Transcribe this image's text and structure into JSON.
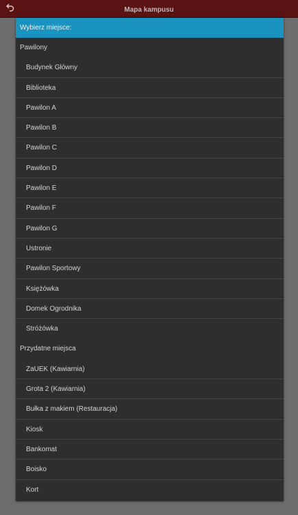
{
  "app_bar": {
    "title": "Mapa kampusu",
    "back_icon": "undo-arrow-icon"
  },
  "dialog": {
    "header": "Wybierz miejsce:",
    "sections": [
      {
        "title": "Pawilony",
        "items": [
          "Budynek Główny",
          "Biblioteka",
          "Pawilon A",
          "Pawilon B",
          "Pawilon C",
          "Pawilon D",
          "Pawilon E",
          "Pawilon F",
          "Pawilon G",
          "Ustronie",
          "Pawilon Sportowy",
          "Księżówka",
          "Domek Ogrodnika",
          "Stróżówka"
        ]
      },
      {
        "title": "Przydatne miejsca",
        "items": [
          "ZaUEK (Kawiarnia)",
          "Grota 2 (Kawiarnia)",
          "Bułka z makiem (Restauracja)",
          "Kiosk",
          "Bankomat",
          "Boisko",
          "Kort"
        ]
      }
    ]
  },
  "colors": {
    "app_bar": "#5a1212",
    "header": "#1a93c0",
    "dialog_bg": "#2e2e2e",
    "backdrop": "#6d6d6d"
  }
}
